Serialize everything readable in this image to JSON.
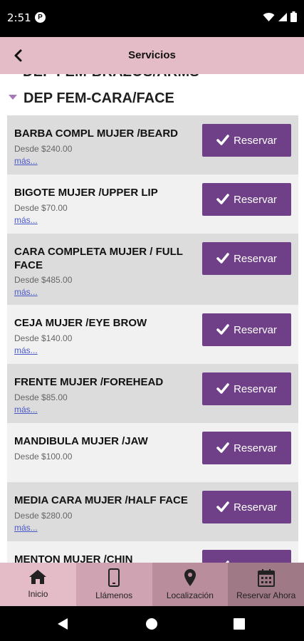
{
  "status": {
    "time": "2:51",
    "notif_glyph": "P"
  },
  "appbar": {
    "title": "Servicios",
    "back_icon": "back-arrow-icon"
  },
  "previous_category": "DEP FEM-BRAZOS/ARMS",
  "category": "DEP FEM-CARA/FACE",
  "button_label": "Reservar",
  "more_label": "más...",
  "services": [
    {
      "name": "BARBA COMPL MUJER /BEARD",
      "price": "Desde $240.00",
      "more": true
    },
    {
      "name": "BIGOTE MUJER /UPPER LIP",
      "price": "Desde $70.00",
      "more": true
    },
    {
      "name": "CARA COMPLETA MUJER / FULL FACE",
      "price": "Desde $485.00",
      "more": true
    },
    {
      "name": "CEJA MUJER /EYE BROW",
      "price": "Desde $140.00",
      "more": true
    },
    {
      "name": "FRENTE MUJER /FOREHEAD",
      "price": "Desde $85.00",
      "more": true
    },
    {
      "name": "MANDIBULA MUJER /JAW",
      "price": "Desde $100.00",
      "more": false
    },
    {
      "name": "MEDIA CARA MUJER /HALF FACE",
      "price": "Desde $280.00",
      "more": true
    },
    {
      "name": "MENTON MUJER /CHIN",
      "price": "",
      "more": false
    }
  ],
  "tabs": [
    {
      "label": "Inicio",
      "icon": "home-icon"
    },
    {
      "label": "Llámenos",
      "icon": "phone-icon"
    },
    {
      "label": "Localización",
      "icon": "location-pin-icon"
    },
    {
      "label": "Reservar Ahora",
      "icon": "calendar-icon"
    }
  ],
  "colors": {
    "accent": "#6f3f87",
    "appbar": "#e4bcc8",
    "link": "#4a57c6"
  }
}
